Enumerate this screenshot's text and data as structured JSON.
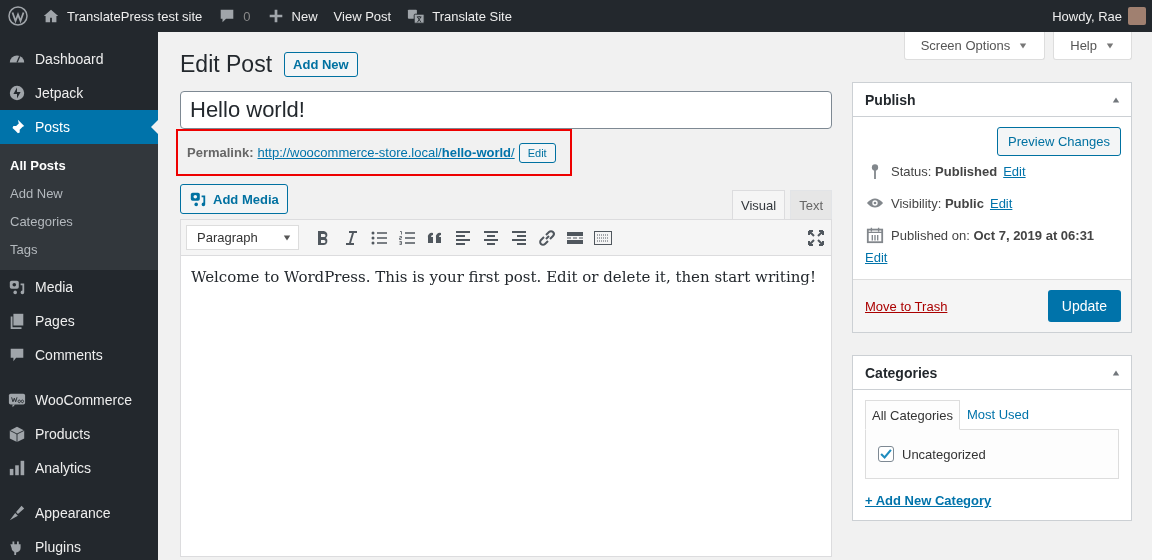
{
  "admin_bar": {
    "items": [
      {
        "label": "TranslatePress test site"
      },
      {
        "label": "0"
      },
      {
        "label": "New"
      },
      {
        "label": "View Post"
      },
      {
        "label": "Translate Site"
      }
    ],
    "account": "Howdy, Rae"
  },
  "sidebar": {
    "groups": [
      {
        "items": [
          {
            "label": "Dashboard",
            "selected": false
          },
          {
            "label": "Jetpack",
            "selected": false
          },
          {
            "label": "Posts",
            "selected": true,
            "children": [
              {
                "label": "All Posts",
                "selected": true
              },
              {
                "label": "Add New",
                "selected": false
              },
              {
                "label": "Categories",
                "selected": false
              },
              {
                "label": "Tags",
                "selected": false
              }
            ]
          },
          {
            "label": "Media",
            "selected": false
          },
          {
            "label": "Pages",
            "selected": false
          },
          {
            "label": "Comments",
            "selected": false
          }
        ]
      },
      {
        "items": [
          {
            "label": "WooCommerce",
            "selected": false
          },
          {
            "label": "Products",
            "selected": false
          },
          {
            "label": "Analytics",
            "selected": false
          }
        ]
      },
      {
        "items": [
          {
            "label": "Appearance",
            "selected": false
          },
          {
            "label": "Plugins",
            "selected": false
          }
        ]
      }
    ]
  },
  "screen_meta": [
    "Screen Options",
    "Help"
  ],
  "heading": {
    "title": "Edit Post",
    "add_new": "Add New"
  },
  "title_field": {
    "value": "Hello world!"
  },
  "permalink": {
    "label": "Permalink:",
    "url": "http://woocommerce-store.local/**hello-world**/",
    "edit": "Edit",
    "highlighted": true
  },
  "editor": {
    "add_media": "Add Media",
    "tabs": [
      {
        "label": "Visual",
        "selected": true
      },
      {
        "label": "Text",
        "selected": false
      }
    ],
    "format": "Paragraph",
    "content": "Welcome to WordPress. This is your first post. Edit or delete it, then start writing!"
  },
  "publish": {
    "title": "Publish",
    "preview": "Preview Changes",
    "rows": [
      {
        "label": "Status:",
        "value": "Published",
        "edit": "Edit"
      },
      {
        "label": "Visibility:",
        "value": "Public",
        "edit": "Edit"
      },
      {
        "label": "Published on:",
        "value": "Oct 7, 2019 at 06:31",
        "edit": "Edit"
      }
    ],
    "trash": "Move to Trash",
    "update": "Update"
  },
  "categories": {
    "title": "Categories",
    "tabs": [
      {
        "label": "All Categories",
        "selected": true
      },
      {
        "label": "Most Used",
        "selected": false
      }
    ],
    "items": [
      {
        "label": "Uncategorized",
        "checked": true
      }
    ],
    "add_new": "+ Add New Category"
  }
}
